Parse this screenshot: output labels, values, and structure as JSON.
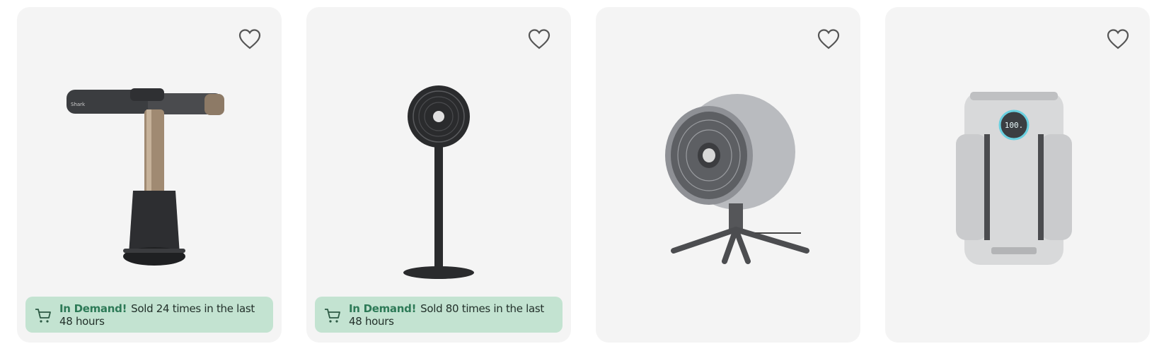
{
  "products": [
    {
      "name": "hair-styler",
      "wishlist_icon": "heart-outline-icon",
      "badge": {
        "highlight": "In Demand!",
        "text": "Sold 24 times in the last 48 hours",
        "icon": "cart-icon"
      }
    },
    {
      "name": "pedestal-fan",
      "wishlist_icon": "heart-outline-icon",
      "badge": {
        "highlight": "In Demand!",
        "text": "Sold 80 times in the last 48 hours",
        "icon": "cart-icon"
      }
    },
    {
      "name": "desk-fan-flexbreeze",
      "wishlist_icon": "heart-outline-icon"
    },
    {
      "name": "air-purifier-clean-sense",
      "wishlist_icon": "heart-outline-icon",
      "display": "100."
    }
  ],
  "colors": {
    "card_bg": "#f4f4f4",
    "badge_bg": "#c3e3d1",
    "badge_highlight": "#2d7a57"
  }
}
